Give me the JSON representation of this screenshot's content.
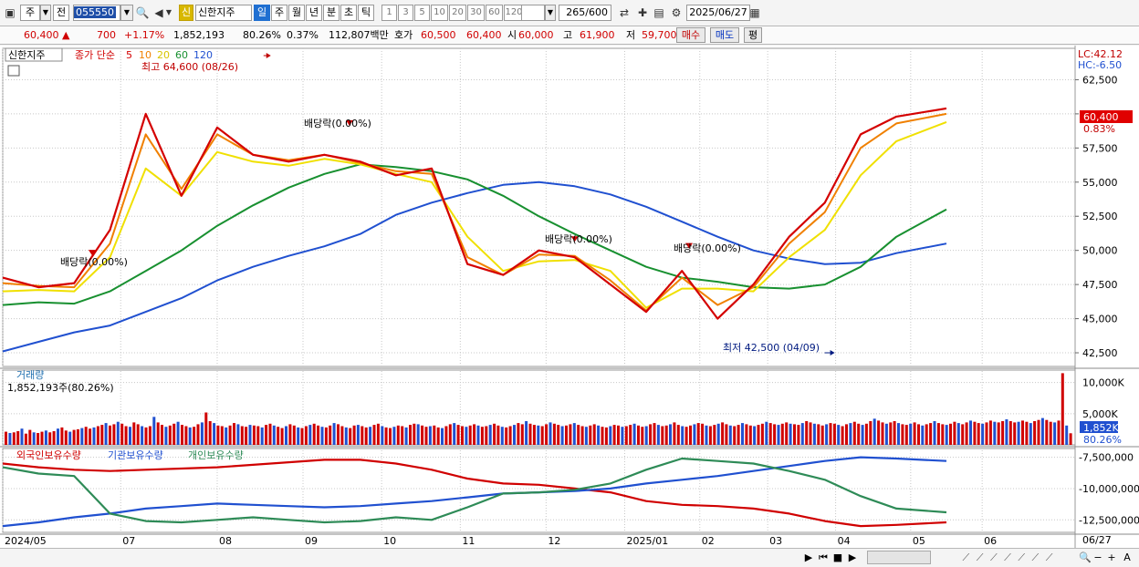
{
  "toolbar": {
    "period_type": "주",
    "prev_label": "전",
    "code": "055550",
    "credit_badge": "신",
    "stock_name": "신한지주",
    "tabs": [
      {
        "label": "일",
        "selected": true
      },
      {
        "label": "주",
        "selected": false
      },
      {
        "label": "월",
        "selected": false
      },
      {
        "label": "년",
        "selected": false
      },
      {
        "label": "분",
        "selected": false
      },
      {
        "label": "초",
        "selected": false
      },
      {
        "label": "틱",
        "selected": false
      }
    ],
    "intervals": [
      "1",
      "3",
      "5",
      "10",
      "20",
      "30",
      "60",
      "120"
    ],
    "count": "265",
    "count_total": "/600",
    "date": "2025/06/27"
  },
  "info": {
    "price": "60,400",
    "change": "700",
    "change_pct": "+1.17%",
    "volume": "1,852,193",
    "vol_ratio": "80.26%",
    "turnover": "0.37%",
    "amount": "112,807백만",
    "ask_label": "호가",
    "ask1": "60,500",
    "ask2": "60,400",
    "open_label": "시",
    "open": "60,000",
    "high_label": "고",
    "high": "61,900",
    "low_label": "저",
    "low": "59,700",
    "buy_label": "매수",
    "sell_label": "매도",
    "eval_label": "평"
  },
  "price_panel": {
    "stock_tag": "신한지주",
    "ma_label": "종가 단순",
    "ma_periods": [
      "5",
      "10",
      "20",
      "60",
      "120"
    ],
    "ma_colors": [
      "#d40000",
      "#f08000",
      "#f0e000",
      "#189030",
      "#2050d0"
    ],
    "high_annotation": "최고 64,600 (08/26)",
    "low_annotation": "최저 42,500 (04/09)",
    "dividend_label": "배당락(0.00%)",
    "lc": "LC:42.12",
    "hc": "HC:-6.50",
    "price_tag": "60,400",
    "price_tag_pct": "0.83%"
  },
  "volume_panel": {
    "title": "거래량",
    "value": "1,852,193주(80.26%)",
    "tag": "1,852K",
    "tag_pct": "80.26%"
  },
  "holdings_panel": {
    "legend": [
      {
        "label": "외국인보유수량",
        "color": "#d00000"
      },
      {
        "label": "기관보유수량",
        "color": "#2050d0"
      },
      {
        "label": "개인보유수량",
        "color": "#2e8b57"
      }
    ]
  },
  "chart_data": {
    "type": "line",
    "title": "",
    "price": {
      "ylim": [
        41500,
        64800
      ],
      "yticks": [
        "62,500",
        "60,000",
        "57,500",
        "55,000",
        "52,500",
        "50,000",
        "47,500",
        "45,000",
        "42,500"
      ],
      "ytick_values": [
        62500,
        60000,
        57500,
        55000,
        52500,
        50000,
        47500,
        45000,
        42500
      ],
      "x": [
        0,
        10,
        20,
        30,
        40,
        50,
        60,
        70,
        80,
        90,
        100,
        110,
        120,
        130,
        140,
        150,
        160,
        170,
        180,
        190,
        200,
        210,
        220,
        230,
        240,
        250,
        264
      ],
      "series": [
        {
          "name": "5",
          "values": [
            48000,
            47300,
            47600,
            51500,
            60000,
            54000,
            59000,
            57000,
            56500,
            57000,
            56500,
            55500,
            56000,
            49000,
            48200,
            50000,
            49500,
            47500,
            45500,
            48500,
            45000,
            47500,
            51000,
            53500,
            58500,
            59800,
            60400
          ]
        },
        {
          "name": "10",
          "values": [
            47600,
            47400,
            47300,
            50500,
            58500,
            54500,
            58500,
            57000,
            56600,
            57000,
            56400,
            55800,
            55600,
            49500,
            48200,
            49700,
            49600,
            47800,
            45600,
            48000,
            46000,
            47300,
            50500,
            52800,
            57500,
            59300,
            60000
          ]
        },
        {
          "name": "20",
          "values": [
            47000,
            47100,
            47000,
            49500,
            56000,
            54000,
            57200,
            56500,
            56200,
            56700,
            56300,
            55600,
            55000,
            51000,
            48500,
            49200,
            49300,
            48500,
            45800,
            47200,
            47200,
            47000,
            49500,
            51500,
            55500,
            58000,
            59400
          ]
        },
        {
          "name": "60",
          "values": [
            46000,
            46200,
            46100,
            47000,
            48500,
            50000,
            51800,
            53300,
            54600,
            55600,
            56300,
            56100,
            55800,
            55200,
            54000,
            52500,
            51200,
            50000,
            48800,
            48000,
            47700,
            47300,
            47200,
            47500,
            48800,
            51000,
            53000
          ]
        },
        {
          "name": "120",
          "values": [
            42600,
            43300,
            44000,
            44500,
            45500,
            46500,
            47800,
            48800,
            49600,
            50300,
            51200,
            52600,
            53500,
            54200,
            54800,
            55000,
            54700,
            54100,
            53200,
            52100,
            51000,
            50000,
            49400,
            49000,
            49100,
            49800,
            50500
          ]
        }
      ],
      "high_marker": {
        "x": 75,
        "value": 64600
      },
      "low_marker": {
        "x": 233,
        "value": 42500
      },
      "dividend_markers": [
        {
          "x": 25,
          "value": 49500
        },
        {
          "x": 97,
          "value": 59000
        },
        {
          "x": 160,
          "value": 50500
        },
        {
          "x": 192,
          "value": 50000
        }
      ]
    },
    "volume": {
      "ylim": [
        0,
        12000000
      ],
      "yticks": [
        "10,000K",
        "5,000K"
      ],
      "ytick_values": [
        10000000,
        5000000
      ],
      "values": [
        2100000,
        1900000,
        2000000,
        2200000,
        2600000,
        1800000,
        2400000,
        2000000,
        1900000,
        2100000,
        2300000,
        2000000,
        2200000,
        2600000,
        2800000,
        2300000,
        2100000,
        2400000,
        2500000,
        2700000,
        2900000,
        2600000,
        2800000,
        3000000,
        3200000,
        3500000,
        3100000,
        3300000,
        3700000,
        3400000,
        3000000,
        2900000,
        3600000,
        3300000,
        3000000,
        2800000,
        3000000,
        4500000,
        3600000,
        3200000,
        2900000,
        3100000,
        3400000,
        3700000,
        3200000,
        3000000,
        2800000,
        2900000,
        3300000,
        3600000,
        5200000,
        3800000,
        3500000,
        3100000,
        3000000,
        2800000,
        3100000,
        3500000,
        3300000,
        3000000,
        2900000,
        3200000,
        3100000,
        3000000,
        2800000,
        3200000,
        3400000,
        3100000,
        2900000,
        2700000,
        3000000,
        3300000,
        3100000,
        2800000,
        2700000,
        3000000,
        3200000,
        3400000,
        3100000,
        2900000,
        2800000,
        3100000,
        3500000,
        3300000,
        3000000,
        2800000,
        2700000,
        3100000,
        3200000,
        3000000,
        2800000,
        2900000,
        3200000,
        3400000,
        3000000,
        2800000,
        2700000,
        2900000,
        3100000,
        3000000,
        2800000,
        3200000,
        3400000,
        3300000,
        3100000,
        2900000,
        3000000,
        3100000,
        2800000,
        2700000,
        3000000,
        3300000,
        3500000,
        3200000,
        3000000,
        2900000,
        3100000,
        3300000,
        3100000,
        2900000,
        3000000,
        3200000,
        3400000,
        3100000,
        2900000,
        2800000,
        3000000,
        3200000,
        3500000,
        3300000,
        3800000,
        3400000,
        3200000,
        3100000,
        3000000,
        3300000,
        3600000,
        3400000,
        3200000,
        3000000,
        3100000,
        3300000,
        3500000,
        3200000,
        3000000,
        2900000,
        3100000,
        3300000,
        3100000,
        2900000,
        2800000,
        3000000,
        3200000,
        3100000,
        2900000,
        3000000,
        3200000,
        3400000,
        3100000,
        2900000,
        3000000,
        3300000,
        3500000,
        3200000,
        3000000,
        3100000,
        3300000,
        3600000,
        3200000,
        3000000,
        2900000,
        3100000,
        3300000,
        3500000,
        3400000,
        3100000,
        3000000,
        3200000,
        3400000,
        3600000,
        3300000,
        3100000,
        3000000,
        3200000,
        3500000,
        3300000,
        3100000,
        3000000,
        3200000,
        3400000,
        3700000,
        3500000,
        3300000,
        3200000,
        3400000,
        3600000,
        3400000,
        3300000,
        3200000,
        3500000,
        3800000,
        3600000,
        3400000,
        3300000,
        3100000,
        3300000,
        3500000,
        3400000,
        3200000,
        3000000,
        3300000,
        3500000,
        3700000,
        3400000,
        3200000,
        3400000,
        3800000,
        4200000,
        3900000,
        3600000,
        3400000,
        3600000,
        3800000,
        3500000,
        3300000,
        3200000,
        3400000,
        3600000,
        3300000,
        3100000,
        3300000,
        3500000,
        3800000,
        3500000,
        3300000,
        3200000,
        3400000,
        3700000,
        3500000,
        3300000,
        3600000,
        3900000,
        3700000,
        3500000,
        3400000,
        3600000,
        3900000,
        3700000,
        3600000,
        3800000,
        4100000,
        3800000,
        3600000,
        3700000,
        3900000,
        3700000,
        3500000,
        3800000,
        4000000,
        4300000,
        4000000,
        3700000,
        3600000,
        3900000,
        11500000,
        3100000,
        1852193
      ]
    },
    "holdings": {
      "ylim": [
        -13500000,
        -6800000
      ],
      "yticks": [
        "-7,500,000",
        "-10,000,000",
        "-12,500,000"
      ],
      "ytick_values": [
        -7500000,
        -10000000,
        -12500000
      ],
      "x": [
        0,
        10,
        20,
        30,
        40,
        50,
        60,
        70,
        80,
        90,
        100,
        110,
        120,
        130,
        140,
        150,
        160,
        170,
        180,
        190,
        200,
        210,
        220,
        230,
        240,
        250,
        264
      ],
      "series": [
        {
          "name": "외국인보유수량",
          "values": [
            -8000000,
            -8300000,
            -8500000,
            -8600000,
            -8500000,
            -8400000,
            -8300000,
            -8100000,
            -7900000,
            -7700000,
            -7700000,
            -8000000,
            -8500000,
            -9200000,
            -9600000,
            -9700000,
            -10000000,
            -10300000,
            -11000000,
            -11300000,
            -11400000,
            -11600000,
            -12000000,
            -12600000,
            -13000000,
            -12900000,
            -12700000
          ]
        },
        {
          "name": "기관보유수량",
          "values": [
            -13000000,
            -12700000,
            -12300000,
            -12000000,
            -11600000,
            -11400000,
            -11200000,
            -11300000,
            -11400000,
            -11500000,
            -11400000,
            -11200000,
            -11000000,
            -10700000,
            -10400000,
            -10300000,
            -10200000,
            -10000000,
            -9600000,
            -9300000,
            -9000000,
            -8600000,
            -8200000,
            -7800000,
            -7500000,
            -7600000,
            -7800000
          ]
        },
        {
          "name": "개인보유수량",
          "values": [
            -8300000,
            -8800000,
            -9000000,
            -12000000,
            -12600000,
            -12700000,
            -12500000,
            -12300000,
            -12500000,
            -12700000,
            -12600000,
            -12300000,
            -12500000,
            -11500000,
            -10400000,
            -10300000,
            -10100000,
            -9600000,
            -8500000,
            -7600000,
            -7800000,
            -8000000,
            -8600000,
            -9300000,
            -10600000,
            -11600000,
            -11900000
          ]
        }
      ]
    },
    "xticks": [
      {
        "label": "2024/05",
        "x": 0
      },
      {
        "label": "07",
        "x": 33
      },
      {
        "label": "08",
        "x": 60
      },
      {
        "label": "09",
        "x": 84
      },
      {
        "label": "10",
        "x": 106
      },
      {
        "label": "11",
        "x": 128
      },
      {
        "label": "12",
        "x": 152
      },
      {
        "label": "2025/01",
        "x": 174
      },
      {
        "label": "02",
        "x": 195
      },
      {
        "label": "03",
        "x": 214
      },
      {
        "label": "04",
        "x": 233
      },
      {
        "label": "05",
        "x": 254
      },
      {
        "label": "06",
        "x": 274
      }
    ],
    "x_range": [
      0,
      300
    ]
  },
  "bottom": {
    "end_date": "06/27"
  }
}
